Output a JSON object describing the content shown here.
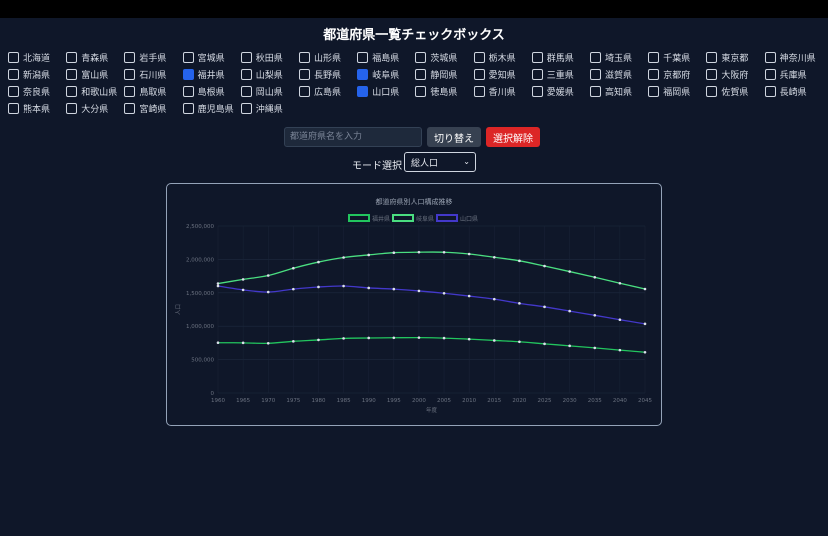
{
  "page_title": "都道府県一覧チェックボックス",
  "prefectures": [
    {
      "name": "北海道",
      "checked": false
    },
    {
      "name": "青森県",
      "checked": false
    },
    {
      "name": "岩手県",
      "checked": false
    },
    {
      "name": "宮城県",
      "checked": false
    },
    {
      "name": "秋田県",
      "checked": false
    },
    {
      "name": "山形県",
      "checked": false
    },
    {
      "name": "福島県",
      "checked": false
    },
    {
      "name": "茨城県",
      "checked": false
    },
    {
      "name": "栃木県",
      "checked": false
    },
    {
      "name": "群馬県",
      "checked": false
    },
    {
      "name": "埼玉県",
      "checked": false
    },
    {
      "name": "千葉県",
      "checked": false
    },
    {
      "name": "東京都",
      "checked": false
    },
    {
      "name": "神奈川県",
      "checked": false
    },
    {
      "name": "新潟県",
      "checked": false
    },
    {
      "name": "富山県",
      "checked": false
    },
    {
      "name": "石川県",
      "checked": false
    },
    {
      "name": "福井県",
      "checked": true
    },
    {
      "name": "山梨県",
      "checked": false
    },
    {
      "name": "長野県",
      "checked": false
    },
    {
      "name": "岐阜県",
      "checked": true
    },
    {
      "name": "静岡県",
      "checked": false
    },
    {
      "name": "愛知県",
      "checked": false
    },
    {
      "name": "三重県",
      "checked": false
    },
    {
      "name": "滋賀県",
      "checked": false
    },
    {
      "name": "京都府",
      "checked": false
    },
    {
      "name": "大阪府",
      "checked": false
    },
    {
      "name": "兵庫県",
      "checked": false
    },
    {
      "name": "奈良県",
      "checked": false
    },
    {
      "name": "和歌山県",
      "checked": false
    },
    {
      "name": "鳥取県",
      "checked": false
    },
    {
      "name": "島根県",
      "checked": false
    },
    {
      "name": "岡山県",
      "checked": false
    },
    {
      "name": "広島県",
      "checked": false
    },
    {
      "name": "山口県",
      "checked": true
    },
    {
      "name": "徳島県",
      "checked": false
    },
    {
      "name": "香川県",
      "checked": false
    },
    {
      "name": "愛媛県",
      "checked": false
    },
    {
      "name": "高知県",
      "checked": false
    },
    {
      "name": "福岡県",
      "checked": false
    },
    {
      "name": "佐賀県",
      "checked": false
    },
    {
      "name": "長崎県",
      "checked": false
    },
    {
      "name": "熊本県",
      "checked": false
    },
    {
      "name": "大分県",
      "checked": false
    },
    {
      "name": "宮崎県",
      "checked": false
    },
    {
      "name": "鹿児島県",
      "checked": false
    },
    {
      "name": "沖縄県",
      "checked": false
    }
  ],
  "controls": {
    "search_placeholder": "都道府県名を入力",
    "toggle_label": "切り替え",
    "clear_label": "選択解除",
    "mode_label": "モード選択",
    "mode_selected": "総人口"
  },
  "colors": {
    "checked": "#2563eb",
    "clear_button": "#dc2626"
  },
  "chart_data": {
    "type": "line",
    "title": "都道府県別人口構成推移",
    "xlabel": "年度",
    "ylabel": "人口",
    "ylim": [
      0,
      2500000
    ],
    "yticks": [
      "0",
      "500,000",
      "1,000,000",
      "1,500,000",
      "2,000,000",
      "2,500,000"
    ],
    "x": [
      1960,
      1965,
      1970,
      1975,
      1980,
      1985,
      1990,
      1995,
      2000,
      2005,
      2010,
      2015,
      2020,
      2025,
      2030,
      2035,
      2040,
      2045
    ],
    "legend_position": "top",
    "series": [
      {
        "name": "福井県",
        "color": "#22c55e",
        "values": [
          752700,
          750600,
          744200,
          773600,
          794400,
          817600,
          823600,
          826900,
          829000,
          822000,
          806300,
          786700,
          766900,
          735900,
          706000,
          675000,
          642000,
          610000
        ]
      },
      {
        "name": "岐阜県",
        "color": "#4ade80",
        "values": [
          1638400,
          1700400,
          1758900,
          1867900,
          1960100,
          2028500,
          2066600,
          2100300,
          2108000,
          2107200,
          2080800,
          2031900,
          1978700,
          1901000,
          1818000,
          1732000,
          1643000,
          1557000
        ]
      },
      {
        "name": "山口県",
        "color": "#4338ca",
        "values": [
          1602200,
          1543600,
          1511400,
          1555200,
          1587100,
          1601600,
          1572600,
          1555500,
          1528000,
          1493000,
          1451300,
          1404700,
          1342100,
          1290000,
          1226000,
          1163000,
          1097000,
          1035000
        ]
      }
    ]
  }
}
